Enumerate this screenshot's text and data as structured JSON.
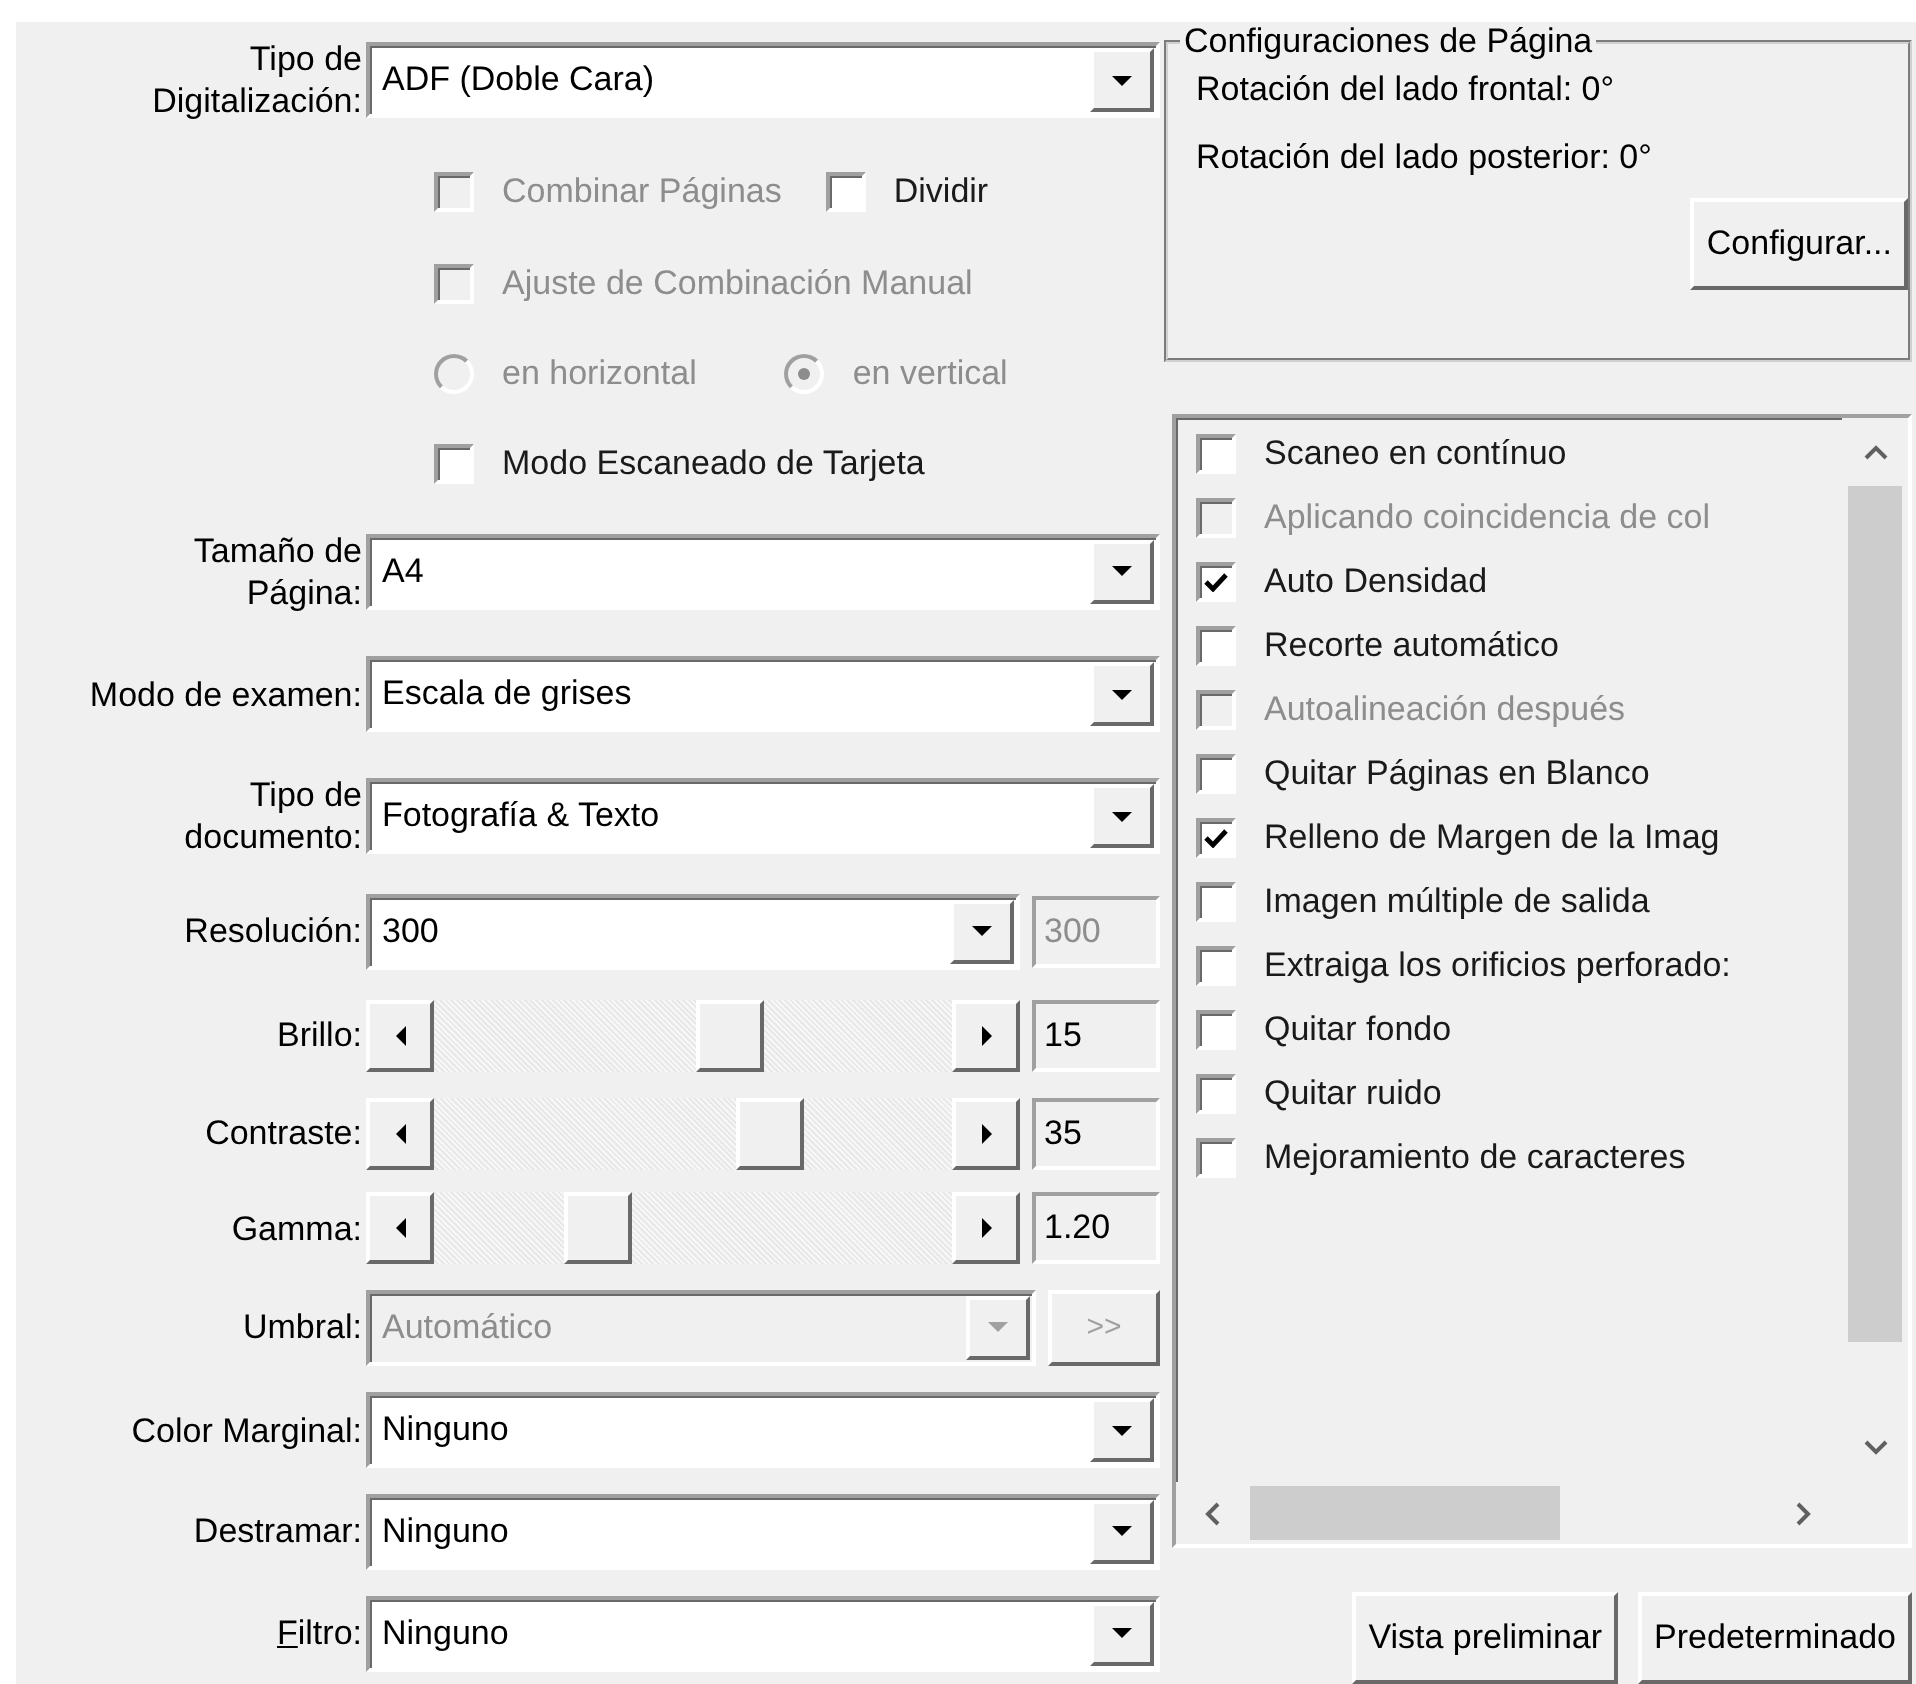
{
  "scan_type": {
    "label_lines": [
      "Tipo de",
      "Digitalización:"
    ],
    "value": "ADF (Doble Cara)"
  },
  "merge_options": [
    {
      "label": "Combinar Páginas",
      "checked": false,
      "disabled": true
    },
    {
      "label": "Dividir",
      "checked": false,
      "disabled": false
    }
  ],
  "manual_merge": {
    "label": "Ajuste de Combinación Manual",
    "checked": false,
    "disabled": true
  },
  "orientation": [
    {
      "label": "en horizontal",
      "selected": false,
      "disabled": true
    },
    {
      "label": "en vertical",
      "selected": true,
      "disabled": true
    }
  ],
  "card_mode": {
    "label": "Modo Escaneado de Tarjeta",
    "checked": false,
    "disabled": false
  },
  "fields": [
    {
      "kind": "combo",
      "label_lines": [
        "Tamaño de",
        "Página:"
      ],
      "value": "A4"
    },
    {
      "kind": "combo",
      "label_lines": [
        "Modo de examen:"
      ],
      "value": "Escala de grises"
    },
    {
      "kind": "combo",
      "label_lines": [
        "Tipo de",
        "documento:"
      ],
      "value": "Fotografía & Texto"
    },
    {
      "kind": "combo_readout",
      "label_lines": [
        "Resolución:"
      ],
      "value": "300",
      "readout": "300",
      "readout_disabled": true
    },
    {
      "kind": "slider",
      "label_lines": [
        "Brillo:"
      ],
      "level": 0.58,
      "reading": "15"
    },
    {
      "kind": "slider",
      "label_lines": [
        "Contraste:"
      ],
      "level": 0.67,
      "reading": "35"
    },
    {
      "kind": "slider",
      "label_lines": [
        "Gamma:"
      ],
      "level": 0.29,
      "reading": "1.20"
    },
    {
      "kind": "combo_button",
      "label_lines": [
        "Umbral:"
      ],
      "value": "Automático",
      "disabled": true,
      "button": ">>"
    },
    {
      "kind": "combo",
      "label_lines": [
        "Color Marginal:"
      ],
      "value": "Ninguno"
    },
    {
      "kind": "combo",
      "label_lines": [
        "Destramar:"
      ],
      "value": "Ninguno"
    },
    {
      "kind": "combo",
      "label_lines": [
        "Filtro:"
      ],
      "underline_first": true,
      "value": "Ninguno"
    }
  ],
  "page_settings": {
    "title": "Configuraciones de Página",
    "lines": [
      "Rotación del lado frontal: 0°",
      "Rotación del lado posterior: 0°"
    ],
    "button": "Configurar..."
  },
  "options": [
    {
      "label": "Scaneo en contínuo",
      "checked": false,
      "disabled": false
    },
    {
      "label": "Aplicando coincidencia de col",
      "checked": false,
      "disabled": true
    },
    {
      "label": "Auto Densidad",
      "checked": true,
      "disabled": false
    },
    {
      "label": "Recorte automático",
      "checked": false,
      "disabled": false
    },
    {
      "label": "Autoalineación después",
      "checked": false,
      "disabled": true
    },
    {
      "label": "Quitar Páginas en Blanco",
      "checked": false,
      "disabled": false
    },
    {
      "label": "Relleno de Margen de la Imag",
      "checked": true,
      "disabled": false
    },
    {
      "label": "Imagen múltiple de salida",
      "checked": false,
      "disabled": false
    },
    {
      "label": "Extraiga los orificios perforado:",
      "checked": false,
      "disabled": false
    },
    {
      "label": "Quitar fondo",
      "checked": false,
      "disabled": false
    },
    {
      "label": "Quitar ruido",
      "checked": false,
      "disabled": false
    },
    {
      "label": "Mejoramiento de caracteres",
      "checked": false,
      "disabled": false
    }
  ],
  "footer_buttons": [
    "Vista preliminar",
    "Predeterminado"
  ]
}
